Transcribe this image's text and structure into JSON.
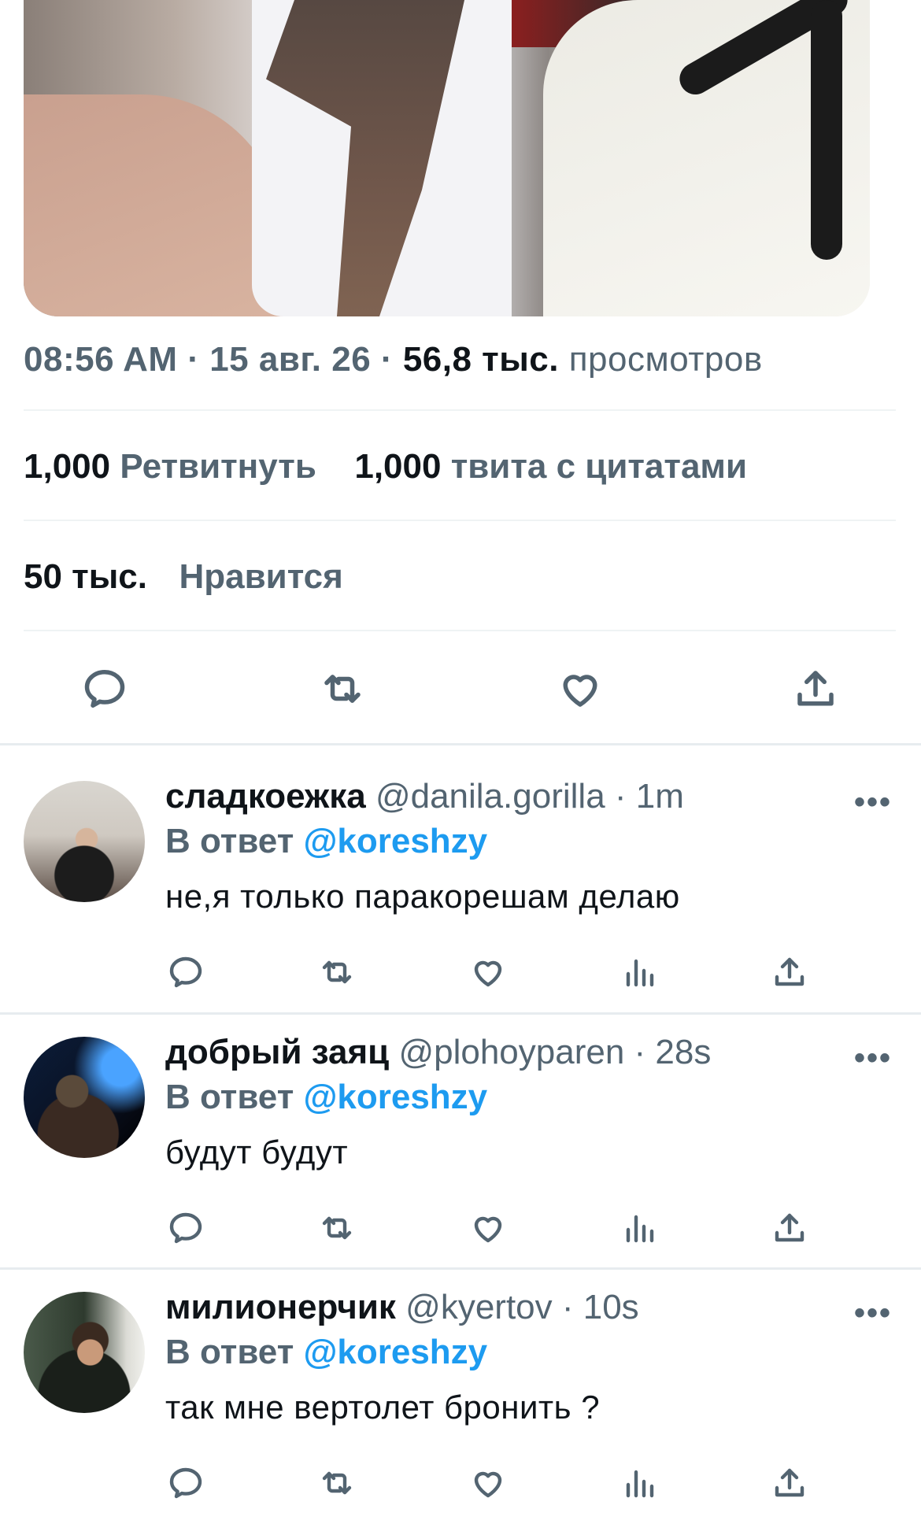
{
  "tweet": {
    "time": "08:56 AM",
    "date": "15 авг. 26",
    "views_count": "56,8 тыс.",
    "views_label": "просмотров",
    "retweets_count": "1,000",
    "retweets_label": "Ретвитнуть",
    "quotes_count": "1,000",
    "quotes_label": "твита с цитатами",
    "likes_count": "50 тыс.",
    "likes_label": "Нравится",
    "sep": "·"
  },
  "icons": {
    "reply": "reply-icon",
    "retweet": "retweet-icon",
    "like": "like-icon",
    "share": "share-icon",
    "views": "views-icon",
    "more": "more-icon"
  },
  "replies": [
    {
      "name": "сладкоежка",
      "handle": "@danila.gorilla · 1m",
      "reply_prefix": "В ответ",
      "mention": "@koreshzy",
      "text": "не,я только паракорешам делаю",
      "more": "•••"
    },
    {
      "name": "добрый заяц",
      "handle": "@plohoyparen · 28s",
      "reply_prefix": "В ответ",
      "mention": "@koreshzy",
      "text": "будут будут",
      "more": "•••"
    },
    {
      "name": "милионерчик",
      "handle": "@kyertov · 10s",
      "reply_prefix": "В ответ",
      "mention": "@koreshzy",
      "text": "так мне вертолет бронить ?",
      "more": "•••"
    }
  ],
  "colors": {
    "text": "#0f1419",
    "secondary": "#536471",
    "link": "#1d9bf0",
    "divider": "#eff3f4"
  }
}
